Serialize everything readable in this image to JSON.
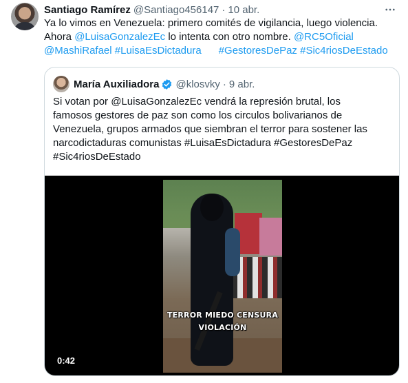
{
  "tweet": {
    "author_name": "Santiago Ramírez",
    "handle": "@Santiago456147",
    "separator": "·",
    "date": "10 abr.",
    "more_icon": "more-horizontal-icon",
    "text": {
      "line1": "Ya lo vimos en Venezuela: primero comités de vigilancia, luego violencia.",
      "line2_prefix": "Ahora ",
      "mention1": "@LuisaGonzalezEc",
      "line2_middle": " lo intenta con otro nombre. ",
      "mention2": "@RC5Oficial",
      "mention3": "@MashiRafael",
      "hashtag1": "#LuisaEsDictadura",
      "hashtag2": "#GestoresDePaz",
      "hashtag3": "#Sic4riosDeEstado"
    }
  },
  "quote": {
    "author_name": "María Auxiliadora",
    "verified_icon": "verified-badge-icon",
    "handle": "@klosvky",
    "separator": "·",
    "date": "9 abr.",
    "text": {
      "line1": "Si votan por @LuisaGonzalezEc vendrá la represión brutal, los",
      "line2": "famosos gestores de paz son como los circulos bolivarianos de",
      "line3": "Venezuela, grupos armados que siembran el terror para sostener las",
      "line4": "narcodictaduras comunistas #LuisaEsDictadura #GestoresDePaz",
      "line5": "#Sic4riosDeEstado"
    },
    "video": {
      "overlay_line1": "TERROR MIEDO CENSURA",
      "overlay_line2": "VIOLACIÓN",
      "duration": "0:42"
    }
  },
  "colors": {
    "link": "#1d9bf0",
    "text": "#0f1419",
    "muted": "#536471",
    "border": "#cfd9de"
  }
}
